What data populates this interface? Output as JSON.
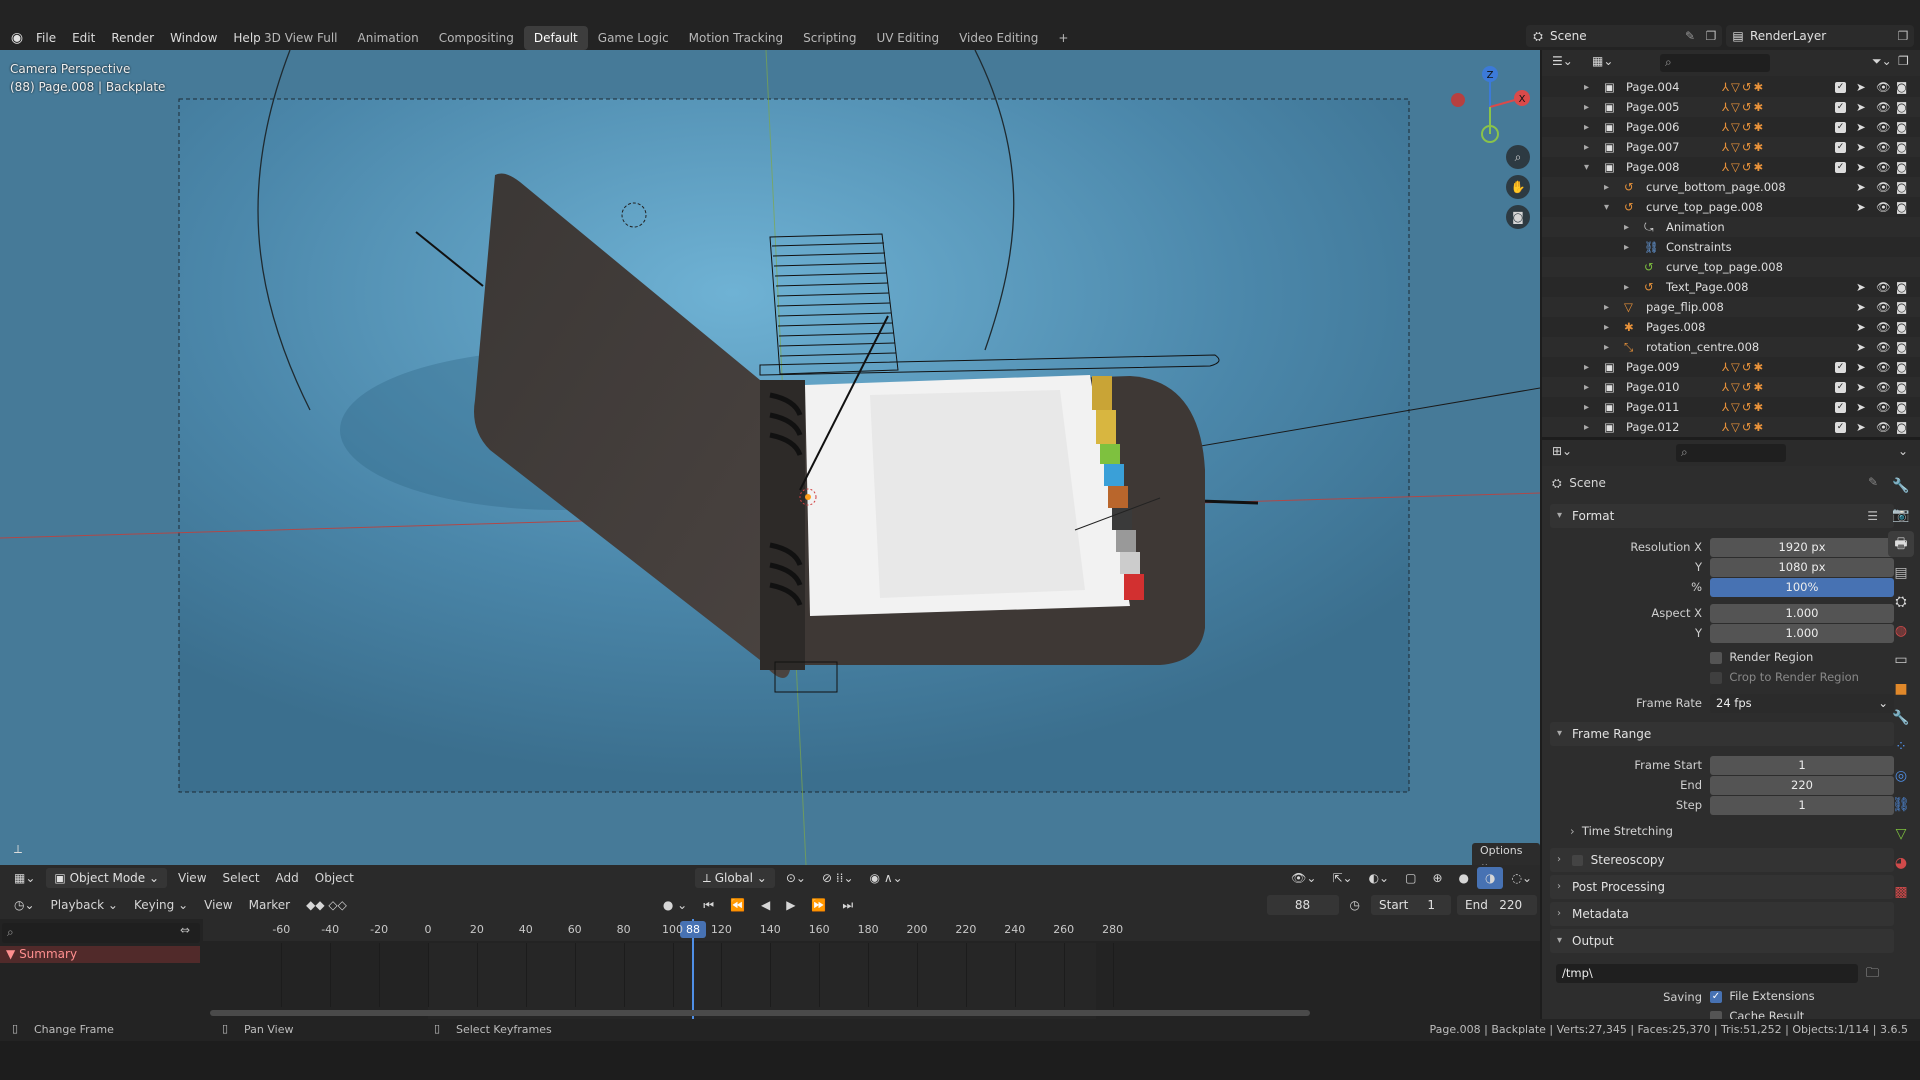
{
  "menu": {
    "items": [
      "File",
      "Edit",
      "Render",
      "Window",
      "Help"
    ]
  },
  "workspaces": {
    "tabs": [
      "3D View Full",
      "Animation",
      "Compositing",
      "Default",
      "Game Logic",
      "Motion Tracking",
      "Scripting",
      "UV Editing",
      "Video Editing"
    ],
    "active": "Default",
    "add": "+"
  },
  "scene": {
    "name": "Scene",
    "render_layer": "RenderLayer"
  },
  "viewport": {
    "view_name": "Camera Perspective",
    "object_info": "(88) Page.008 | Backplate",
    "options_label": "Options",
    "nav_x": "X",
    "nav_y": "Y",
    "nav_z": "Z"
  },
  "view_toolbar": {
    "mode": "Object Mode",
    "menus": [
      "View",
      "Select",
      "Add",
      "Object"
    ],
    "orientation": "Global"
  },
  "timeline": {
    "menus": [
      "Playback",
      "Keying",
      "View",
      "Marker"
    ],
    "current_frame": "88",
    "start_label": "Start",
    "start": "1",
    "end_label": "End",
    "end": "220",
    "ticks": [
      "-60",
      "-40",
      "-20",
      "0",
      "20",
      "40",
      "60",
      "80",
      "100",
      "120",
      "140",
      "160",
      "180",
      "200",
      "220",
      "240",
      "260",
      "280"
    ],
    "summary": "Summary"
  },
  "statusbar": {
    "hint1": "Change Frame",
    "hint2": "Pan View",
    "hint3": "Select Keyframes",
    "stats": "Page.008 | Backplate | Verts:27,345 | Faces:25,370 | Tris:51,252 | Objects:1/114 | 3.6.5"
  },
  "outliner": {
    "rows": [
      {
        "indent": 0,
        "exp": "▸",
        "label": "Page.004",
        "kind": "collection"
      },
      {
        "indent": 0,
        "exp": "▸",
        "label": "Page.005",
        "kind": "collection"
      },
      {
        "indent": 0,
        "exp": "▸",
        "label": "Page.006",
        "kind": "collection"
      },
      {
        "indent": 0,
        "exp": "▸",
        "label": "Page.007",
        "kind": "collection"
      },
      {
        "indent": 0,
        "exp": "▾",
        "label": "Page.008",
        "kind": "collection"
      },
      {
        "indent": 1,
        "exp": "▸",
        "label": "curve_bottom_page.008",
        "kind": "curve"
      },
      {
        "indent": 1,
        "exp": "▾",
        "label": "curve_top_page.008",
        "kind": "curve"
      },
      {
        "indent": 2,
        "exp": "▸",
        "label": "Animation",
        "kind": "anim"
      },
      {
        "indent": 2,
        "exp": "▸",
        "label": "Constraints",
        "kind": "constraint"
      },
      {
        "indent": 2,
        "exp": "",
        "label": "curve_top_page.008",
        "kind": "curvedata"
      },
      {
        "indent": 2,
        "exp": "▸",
        "label": "Text_Page.008",
        "kind": "curve"
      },
      {
        "indent": 1,
        "exp": "▸",
        "label": "page_flip.008",
        "kind": "mesh"
      },
      {
        "indent": 1,
        "exp": "▸",
        "label": "Pages.008",
        "kind": "armature"
      },
      {
        "indent": 1,
        "exp": "▸",
        "label": "rotation_centre.008",
        "kind": "empty"
      },
      {
        "indent": 0,
        "exp": "▸",
        "label": "Page.009",
        "kind": "collection"
      },
      {
        "indent": 0,
        "exp": "▸",
        "label": "Page.010",
        "kind": "collection"
      },
      {
        "indent": 0,
        "exp": "▸",
        "label": "Page.011",
        "kind": "collection"
      },
      {
        "indent": 0,
        "exp": "▸",
        "label": "Page.012",
        "kind": "collection"
      }
    ]
  },
  "properties": {
    "context": "Scene",
    "format": {
      "title": "Format",
      "res_x_label": "Resolution X",
      "res_x": "1920 px",
      "res_y_label": "Y",
      "res_y": "1080 px",
      "pct_label": "%",
      "pct": "100%",
      "aspect_x_label": "Aspect X",
      "aspect_x": "1.000",
      "aspect_y_label": "Y",
      "aspect_y": "1.000",
      "render_region": "Render Region",
      "crop": "Crop to Render Region",
      "frame_rate_label": "Frame Rate",
      "frame_rate": "24 fps"
    },
    "frame_range": {
      "title": "Frame Range",
      "start_label": "Frame Start",
      "start": "1",
      "end_label": "End",
      "end": "220",
      "step_label": "Step",
      "step": "1",
      "time_stretching": "Time Stretching"
    },
    "stereoscopy": "Stereoscopy",
    "post_processing": "Post Processing",
    "metadata": "Metadata",
    "output": {
      "title": "Output",
      "path": "/tmp\\",
      "saving_label": "Saving",
      "file_ext": "File Extensions",
      "cache_result": "Cache Result"
    }
  },
  "colors": {
    "accent": "#4772b3",
    "viewport_bg": "#4b7d9c",
    "playhead": "#4f8fe6"
  }
}
